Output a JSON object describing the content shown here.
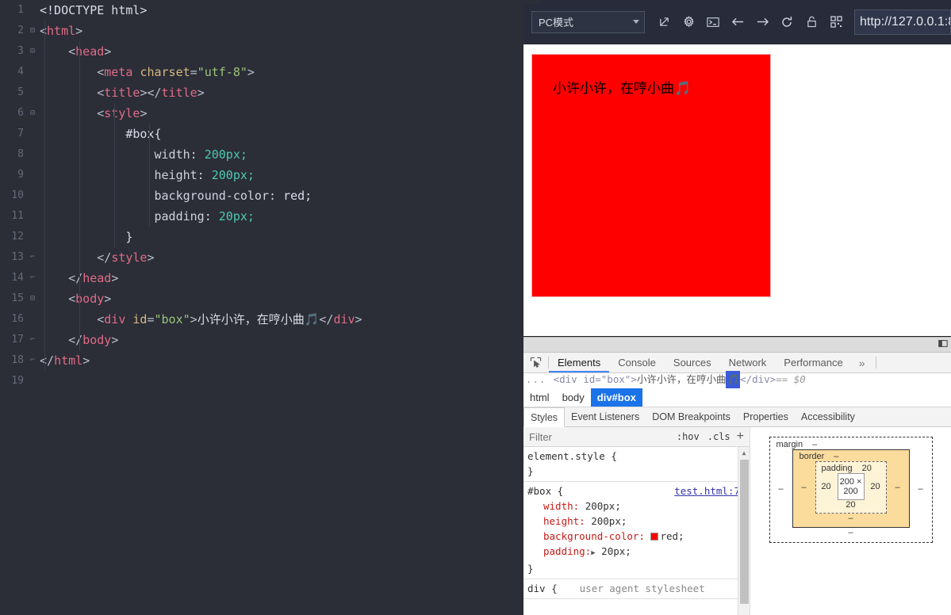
{
  "editor": {
    "lines": [
      {
        "n": "1",
        "fold": "",
        "indent": 0
      },
      {
        "n": "2",
        "fold": "⊟",
        "indent": 0
      },
      {
        "n": "3",
        "fold": "⊟",
        "indent": 1
      },
      {
        "n": "4",
        "fold": "",
        "indent": 2
      },
      {
        "n": "5",
        "fold": "",
        "indent": 2
      },
      {
        "n": "6",
        "fold": "⊟",
        "indent": 2
      },
      {
        "n": "7",
        "fold": "",
        "indent": 3
      },
      {
        "n": "8",
        "fold": "",
        "indent": 4
      },
      {
        "n": "9",
        "fold": "",
        "indent": 4
      },
      {
        "n": "10",
        "fold": "",
        "indent": 4
      },
      {
        "n": "11",
        "fold": "",
        "indent": 4
      },
      {
        "n": "12",
        "fold": "",
        "indent": 3
      },
      {
        "n": "13",
        "fold": "⌐",
        "indent": 2
      },
      {
        "n": "14",
        "fold": "⌐",
        "indent": 1
      },
      {
        "n": "15",
        "fold": "⊟",
        "indent": 1
      },
      {
        "n": "16",
        "fold": "",
        "indent": 2
      },
      {
        "n": "17",
        "fold": "⌐",
        "indent": 1
      },
      {
        "n": "18",
        "fold": "⌐",
        "indent": 0
      },
      {
        "n": "19",
        "fold": "",
        "indent": 0
      }
    ],
    "code": {
      "l1": "<!DOCTYPE html>",
      "l2_tag": "html",
      "l3_tag": "head",
      "l4_tag": "meta",
      "l4_attr": "charset",
      "l4_val": "\"utf-8\"",
      "l5_tag": "title",
      "l6_tag": "style",
      "l7_sel": "#box{",
      "l8_prop": "width:",
      "l8_val": "200px;",
      "l9_prop": "height:",
      "l9_val": "200px;",
      "l10_prop": "background-color:",
      "l10_val": "red;",
      "l11_prop": "padding:",
      "l11_val": "20px;",
      "l12_brace": "}",
      "l13_tag": "style",
      "l14_tag": "head",
      "l15_tag": "body",
      "l16_tag": "div",
      "l16_attr": "id",
      "l16_val": "\"box\"",
      "l16_text": "小许小许，在哼小曲🎵",
      "l17_tag": "body",
      "l18_tag": "html"
    }
  },
  "toolbar": {
    "device_mode": "PC模式",
    "url": "http://127.0.0.1:8",
    "icons": [
      {
        "name": "open-external-icon"
      },
      {
        "name": "gear-icon"
      },
      {
        "name": "console-icon"
      },
      {
        "name": "back-arrow-icon"
      },
      {
        "name": "forward-arrow-icon"
      },
      {
        "name": "reload-icon"
      },
      {
        "name": "lock-icon"
      },
      {
        "name": "qrcode-icon"
      }
    ]
  },
  "viewport": {
    "box_text": "小许小许，在哼小曲",
    "box_note": "🎵",
    "box_color": "#ff0000"
  },
  "devtools": {
    "tabs": [
      {
        "label": "Elements",
        "active": true
      },
      {
        "label": "Console",
        "active": false
      },
      {
        "label": "Sources",
        "active": false
      },
      {
        "label": "Network",
        "active": false
      },
      {
        "label": "Performance",
        "active": false
      }
    ],
    "more_label": "»",
    "dom_line": {
      "dots": "...",
      "open": "<div id=\"box\">",
      "text": "小许小许，在哼小曲",
      "music": "🎵",
      "close": "</div>",
      "selected": "== $0"
    },
    "breadcrumbs": [
      {
        "label": "html",
        "active": false
      },
      {
        "label": "body",
        "active": false
      },
      {
        "label": "div#box",
        "active": true
      }
    ],
    "side_tabs": [
      {
        "label": "Styles",
        "active": true
      },
      {
        "label": "Event Listeners",
        "active": false
      },
      {
        "label": "DOM Breakpoints",
        "active": false
      },
      {
        "label": "Properties",
        "active": false
      },
      {
        "label": "Accessibility",
        "active": false
      }
    ],
    "filter": {
      "placeholder": "Filter",
      "hov": ":hov",
      "cls": ".cls",
      "plus": "+"
    },
    "rules": [
      {
        "selector": "element.style {",
        "source": "",
        "declarations": [],
        "close": "}"
      },
      {
        "selector": "#box {",
        "source": "test.html:7",
        "declarations": [
          {
            "prop": "width:",
            "value": "200px;",
            "swatch": false,
            "toggle": false
          },
          {
            "prop": "height:",
            "value": "200px;",
            "swatch": false,
            "toggle": false
          },
          {
            "prop": "background-color:",
            "value": "red;",
            "swatch": true,
            "toggle": false
          },
          {
            "prop": "padding:",
            "value": "20px;",
            "swatch": false,
            "toggle": true
          }
        ],
        "close": "}"
      },
      {
        "selector": "div {",
        "source": "user agent stylesheet",
        "declarations": [],
        "close": ""
      }
    ],
    "box_model": {
      "margin_label": "margin",
      "margin_top": "–",
      "margin_bottom": "–",
      "margin_left": "–",
      "margin_right": "–",
      "border_label": "border",
      "border_top": "–",
      "border_bottom": "–",
      "border_left": "–",
      "border_right": "–",
      "padding_label": "padding",
      "padding_top": "20",
      "padding_bottom": "20",
      "padding_left": "20",
      "padding_right": "20",
      "content": "200 × 200"
    }
  }
}
